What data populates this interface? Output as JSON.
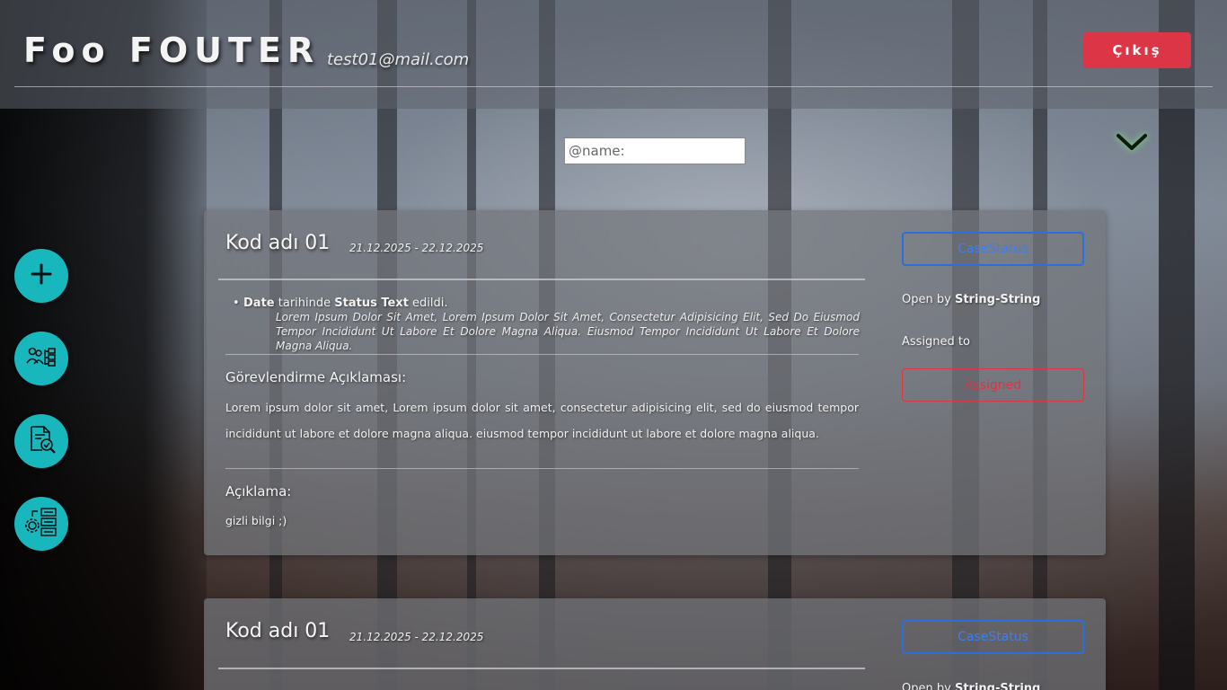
{
  "header": {
    "brand": "Foo FOUTER",
    "email": "test01@mail.com",
    "logout_label": "Çıkış"
  },
  "search": {
    "placeholder": "@name:"
  },
  "sidebar": {
    "buttons": [
      {
        "icon": "plus-icon"
      },
      {
        "icon": "org-users-icon"
      },
      {
        "icon": "document-search-check-icon"
      },
      {
        "icon": "settings-workflow-icon"
      }
    ]
  },
  "colors": {
    "accent": "#17b7bd",
    "danger": "#dc3545",
    "primary": "#2b6fdf"
  },
  "cases": [
    {
      "title": "Kod adı 01",
      "dates": "21.12.2025 - 22.12.2025",
      "status_label": "CaseStatus",
      "open_by_prefix": "Open by",
      "open_by_name": "String-String",
      "assigned_to_label": "Assigned to",
      "assigned_label": "Assigned",
      "log": {
        "date": "Date",
        "mid": "tarihinde",
        "status": "Status Text",
        "end": "edildi.",
        "detail": "Lorem Ipsum Dolor Sit Amet, Lorem Ipsum Dolor Sit Amet, Consectetur Adipisicing Elit, Sed Do Eiusmod Tempor Incididunt Ut Labore Et Dolore Magna Aliqua. Eiusmod Tempor Incididunt Ut Labore Et Dolore Magna Aliqua."
      },
      "assignment_title": "Görevlendirme Açıklaması:",
      "assignment_text": "Lorem ipsum dolor sit amet, Lorem ipsum dolor sit amet, consectetur adipisicing elit, sed do eiusmod tempor incididunt ut labore et dolore magna aliqua. eiusmod tempor incididunt ut labore et dolore magna aliqua.",
      "description_title": "Açıklama:",
      "description_text": "gizli bilgi ;)"
    },
    {
      "title": "Kod adı 01",
      "dates": "21.12.2025 - 22.12.2025",
      "status_label": "CaseStatus",
      "open_by_prefix": "Open by",
      "open_by_name": "String-String"
    }
  ]
}
